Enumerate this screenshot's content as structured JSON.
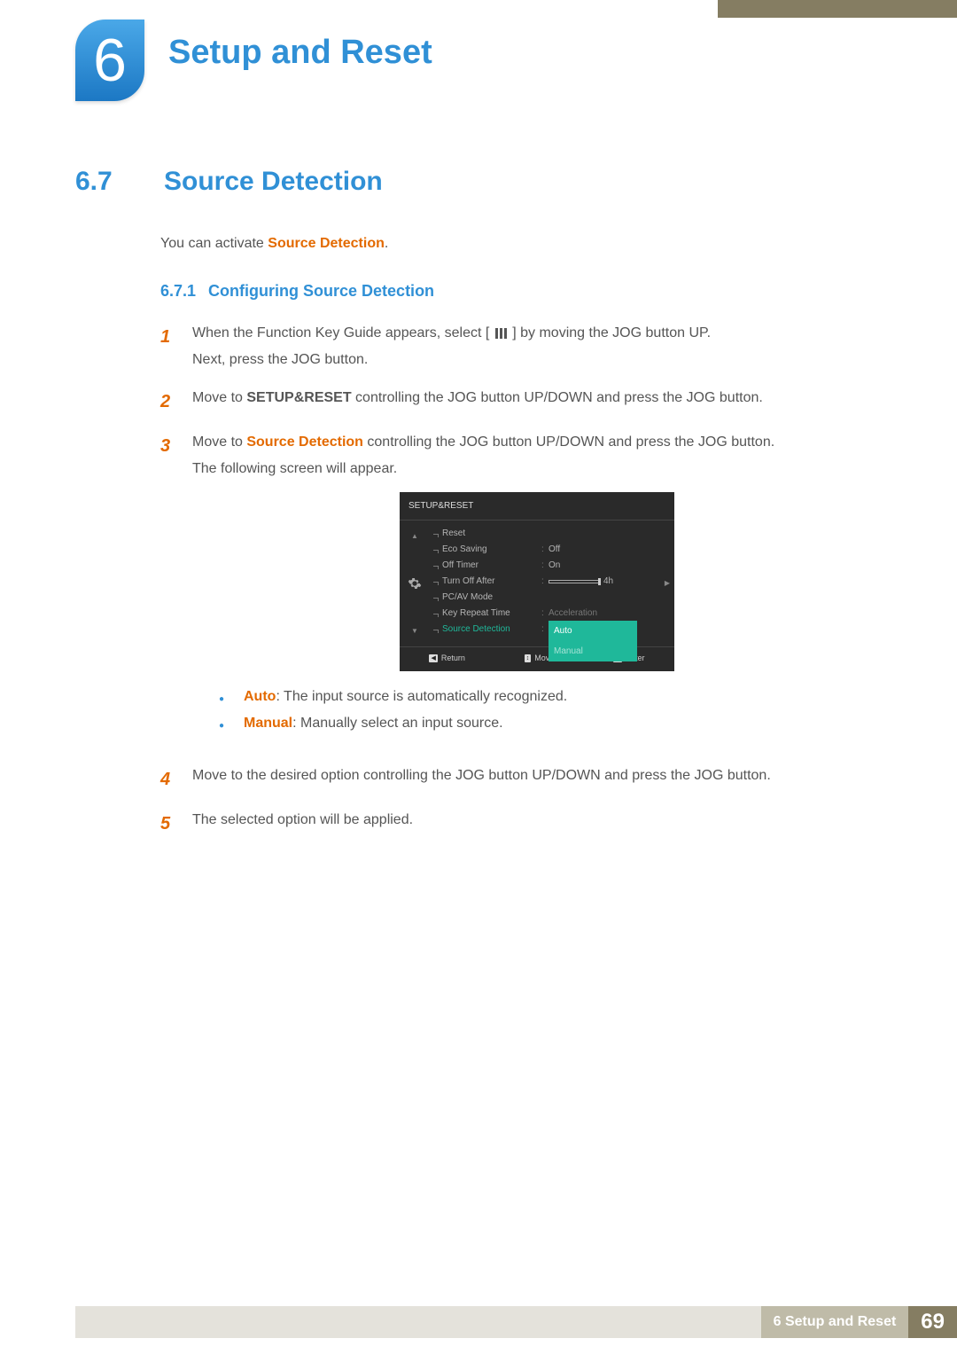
{
  "chapter": {
    "number": "6",
    "title": "Setup and Reset"
  },
  "section": {
    "number": "6.7",
    "title": "Source Detection"
  },
  "intro": {
    "pre": "You can activate ",
    "bold": "Source Detection",
    "post": "."
  },
  "subsection": {
    "number": "6.7.1",
    "title": "Configuring Source Detection"
  },
  "steps": {
    "s1": {
      "num": "1",
      "a": "When the Function Key Guide appears, select ",
      "lb": "[",
      "rb": "]",
      "b": " by moving the JOG button UP.",
      "c": "Next, press the JOG button."
    },
    "s2": {
      "num": "2",
      "a": "Move to ",
      "bold": "SETUP&RESET",
      "b": " controlling the JOG button UP/DOWN and press the JOG button."
    },
    "s3": {
      "num": "3",
      "a": "Move to ",
      "bold": "Source Detection",
      "b": " controlling the JOG button UP/DOWN and press the JOG button.",
      "c": "The following screen will appear."
    },
    "s4": {
      "num": "4",
      "text": "Move to the desired option controlling the JOG button UP/DOWN and press the JOG button."
    },
    "s5": {
      "num": "5",
      "text": "The selected option will be applied."
    }
  },
  "osd": {
    "title": "SETUP&RESET",
    "rows": {
      "reset": "Reset",
      "eco": {
        "label": "Eco Saving",
        "val": "Off"
      },
      "timer": {
        "label": "Off Timer",
        "val": "On"
      },
      "turnoff": {
        "label": "Turn Off After",
        "val": "4h"
      },
      "pcav": "PC/AV Mode",
      "repeat": {
        "label": "Key Repeat Time",
        "val": "Acceleration"
      },
      "source": {
        "label": "Source Detection",
        "opt1": "Auto",
        "opt2": "Manual"
      }
    },
    "footer": {
      "return": "Return",
      "move": "Move",
      "enter": "Enter"
    }
  },
  "bullets": {
    "auto": {
      "bold": "Auto",
      "text": ": The input source is automatically recognized."
    },
    "manual": {
      "bold": "Manual",
      "text": ": Manually select an input source."
    }
  },
  "footer": {
    "label": "6 Setup and Reset",
    "page": "69"
  }
}
